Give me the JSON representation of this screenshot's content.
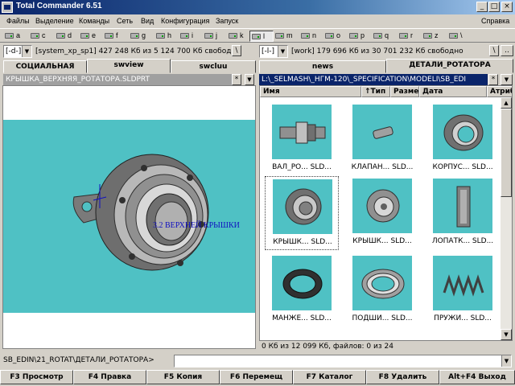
{
  "window": {
    "title": "Total Commander 6.51",
    "help_menu": "Справка"
  },
  "menu": [
    "Файлы",
    "Выделение",
    "Команды",
    "Сеть",
    "Вид",
    "Конфигурация",
    "Запуск"
  ],
  "drives": [
    "a",
    "c",
    "d",
    "e",
    "f",
    "g",
    "h",
    "i",
    "j",
    "k",
    "l",
    "m",
    "n",
    "o",
    "p",
    "q",
    "r",
    "z",
    "\\"
  ],
  "active_drive": "l",
  "left_panel": {
    "drive": "[-d-]",
    "volume_info": "[system_xp_sp1]  427 248 Кб из 5 124 700 Кб свобод",
    "root_btn": "\\",
    "tabs": [
      "СОЦИАЛЬНАЯ",
      "swview",
      "swcluu"
    ],
    "path": "КРЫШКА_ВЕРХНЯЯ_РОТАТОРА.SLDPRT",
    "star": "*",
    "scroll_btn": "▼",
    "viewer_label": "3.2 ВЕРХНЕЙ КРЫШКИ"
  },
  "right_panel": {
    "drive": "[-l-]",
    "volume_info": "[work]  179 696 Кб из 30 701 232 Кб свободно",
    "root_btn": "\\",
    "up_btn": "..",
    "tabs": [
      "news",
      "ДЕТАЛИ_РОТАТОРА"
    ],
    "path": "L:\\_SELMASH\\_НГМ-120\\_SPECIFICATION\\MODELI\\SB_EDI",
    "star": "*",
    "scroll_btn": "▼",
    "columns": [
      "Имя",
      "↑Тип",
      "Размер",
      "Дата",
      "Атрибу"
    ],
    "thumbnails": [
      {
        "name": "ВАЛ_РО...  SLD...",
        "icon": "shaft-icon"
      },
      {
        "name": "КЛАПАН...  SLD...",
        "icon": "valve-icon"
      },
      {
        "name": "КОРПУС...  SLD...",
        "icon": "housing-icon"
      },
      {
        "name": "КРЫШК...  SLD...",
        "icon": "cover-icon"
      },
      {
        "name": "КРЫШК...  SLD...",
        "icon": "cover-icon"
      },
      {
        "name": "ЛОПАТК...  SLD...",
        "icon": "blade-icon"
      },
      {
        "name": "МАНЖЕ...  SLD...",
        "icon": "seal-icon"
      },
      {
        "name": "ПОДШИ...  SLD...",
        "icon": "bearing-icon"
      },
      {
        "name": "ПРУЖИ...  SLD...",
        "icon": "spring-icon"
      }
    ],
    "status": "0 Кб из 12 099 Кб, файлов: 0 из 24"
  },
  "command_line": {
    "prompt": "SB_EDIN\\21_ROTAT\\ДЕТАЛИ_РОТАТОРА>",
    "value": ""
  },
  "fkeys": [
    "F3 Просмотр",
    "F4 Правка",
    "F5 Копия",
    "F6 Перемещ",
    "F7 Каталог",
    "F8 Удалить",
    "Alt+F4 Выход"
  ],
  "colors": {
    "titlebar": "#0a246a",
    "teal_background": "#4fc1c4",
    "window_face": "#d4d0c8"
  }
}
